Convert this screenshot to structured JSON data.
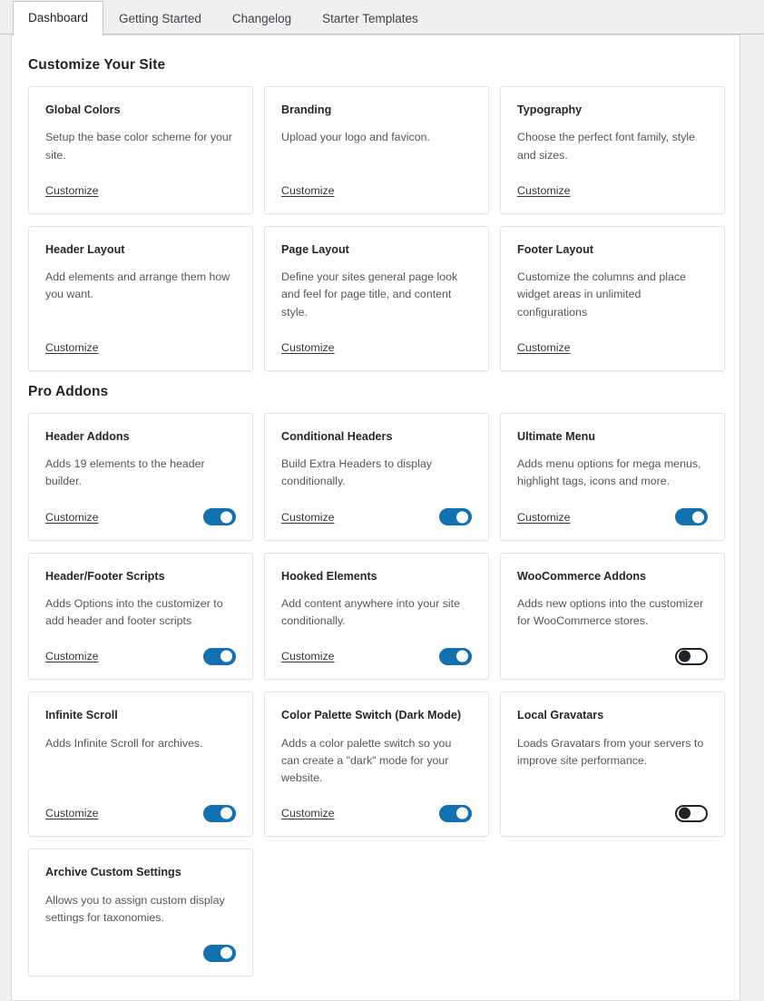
{
  "tabs": [
    {
      "label": "Dashboard",
      "active": true
    },
    {
      "label": "Getting Started",
      "active": false
    },
    {
      "label": "Changelog",
      "active": false
    },
    {
      "label": "Starter Templates",
      "active": false
    }
  ],
  "colors": {
    "toggle_on": "#1271b1",
    "toggle_off_border": "#1d2327",
    "page_background": "#f0f0f1",
    "panel_background": "#ffffff",
    "card_border": "#e2e4e7",
    "title_text": "#1d2327",
    "body_text": "#50575e"
  },
  "labels": {
    "customize": "Customize"
  },
  "sections": [
    {
      "id": "customize-your-site",
      "title": "Customize Your Site",
      "cards": [
        {
          "title": "Global Colors",
          "description": "Setup the base color scheme for your site.",
          "link": "Customize",
          "toggle": null
        },
        {
          "title": "Branding",
          "description": "Upload your logo and favicon.",
          "link": "Customize",
          "toggle": null
        },
        {
          "title": "Typography",
          "description": "Choose the perfect font family, style and sizes.",
          "link": "Customize",
          "toggle": null
        },
        {
          "title": "Header Layout",
          "description": "Add elements and arrange them how you want.",
          "link": "Customize",
          "toggle": null
        },
        {
          "title": "Page Layout",
          "description": "Define your sites general page look and feel for page title, and content style.",
          "link": "Customize",
          "toggle": null
        },
        {
          "title": "Footer Layout",
          "description": "Customize the columns and place widget areas in unlimited configurations",
          "link": "Customize",
          "toggle": null
        }
      ]
    },
    {
      "id": "pro-addons",
      "title": "Pro Addons",
      "cards": [
        {
          "title": "Header Addons",
          "description": "Adds 19 elements to the header builder.",
          "link": "Customize",
          "toggle": "on"
        },
        {
          "title": "Conditional Headers",
          "description": "Build Extra Headers to display conditionally.",
          "link": "Customize",
          "toggle": "on"
        },
        {
          "title": "Ultimate Menu",
          "description": "Adds menu options for mega menus, highlight tags, icons and more.",
          "link": "Customize",
          "toggle": "on"
        },
        {
          "title": "Header/Footer Scripts",
          "description": "Adds Options into the customizer to add header and footer scripts",
          "link": "Customize",
          "toggle": "on"
        },
        {
          "title": "Hooked Elements",
          "description": "Add content anywhere into your site conditionally.",
          "link": "Customize",
          "toggle": "on"
        },
        {
          "title": "WooCommerce Addons",
          "description": "Adds new options into the customizer for WooCommerce stores.",
          "link": null,
          "toggle": "off"
        },
        {
          "title": "Infinite Scroll",
          "description": "Adds Infinite Scroll for archives.",
          "link": "Customize",
          "toggle": "on"
        },
        {
          "title": "Color Palette Switch (Dark Mode)",
          "description": "Adds a color palette switch so you can create a \"dark\" mode for your website.",
          "link": "Customize",
          "toggle": "on"
        },
        {
          "title": "Local Gravatars",
          "description": "Loads Gravatars from your servers to improve site performance.",
          "link": null,
          "toggle": "off"
        },
        {
          "title": "Archive Custom Settings",
          "description": "Allows you to assign custom display settings for taxonomies.",
          "link": null,
          "toggle": "on"
        }
      ]
    }
  ]
}
